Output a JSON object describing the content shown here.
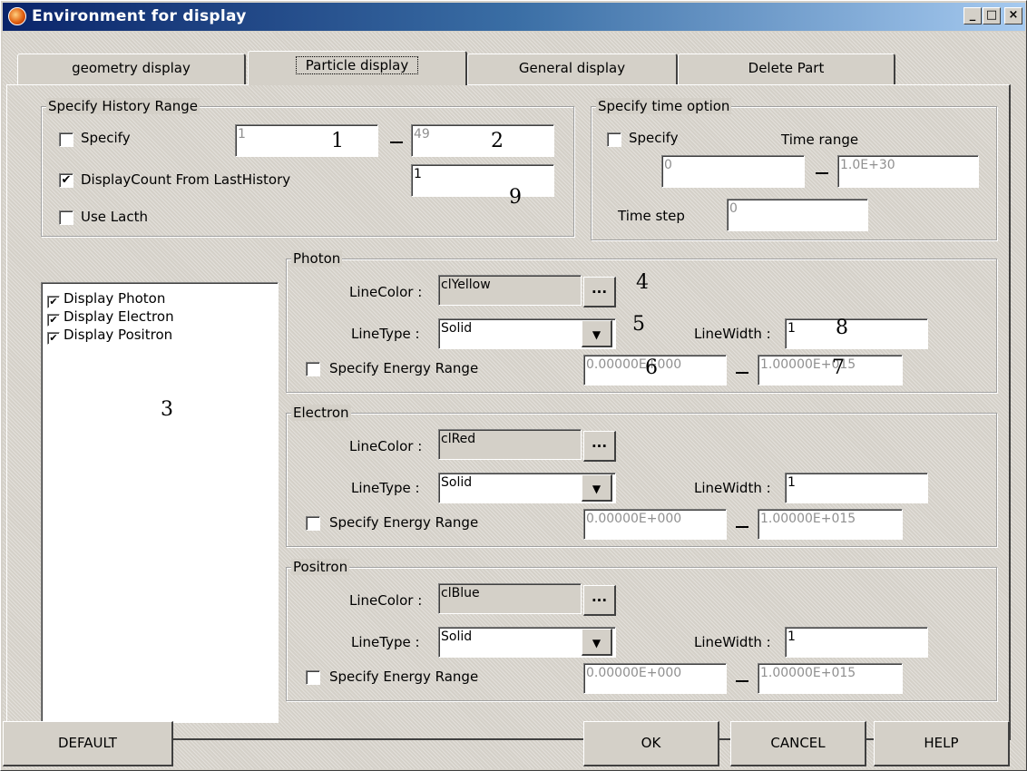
{
  "window": {
    "title": "Environment for display",
    "minimize": "_",
    "maximize": "□",
    "close": "×"
  },
  "tabs": [
    "geometry display",
    "Particle display",
    "General display",
    "Delete Part"
  ],
  "history": {
    "legend": "Specify History Range",
    "specify_label": "Specify",
    "specify_checked": false,
    "from_value": "1",
    "to_value": "49",
    "displaycount_label": "DisplayCount From LastHistory",
    "displaycount_checked": true,
    "displaycount_value": "1",
    "uselacth_label": "Use Lacth",
    "uselacth_checked": false
  },
  "time": {
    "legend": "Specify time option",
    "specify_label": "Specify",
    "specify_checked": false,
    "range_label": "Time range",
    "range_from": "0",
    "range_to": "1.0E+30",
    "step_label": "Time step",
    "step_value": "0"
  },
  "display_list": [
    {
      "label": "Display Photon",
      "checked": true
    },
    {
      "label": "Display Electron",
      "checked": true
    },
    {
      "label": "Display Positron",
      "checked": true
    }
  ],
  "particles": [
    {
      "legend": "Photon",
      "linecolor_label": "LineColor :",
      "linecolor_value": "clYellow",
      "browse_label": "...",
      "linetype_label": "LineType :",
      "linetype_value": "Solid",
      "linewidth_label": "LineWidth :",
      "linewidth_value": "1",
      "energy_label": "Specify Energy Range",
      "energy_checked": false,
      "energy_from": "0.00000E+000",
      "energy_to": "1.00000E+015"
    },
    {
      "legend": "Electron",
      "linecolor_label": "LineColor :",
      "linecolor_value": "clRed",
      "browse_label": "...",
      "linetype_label": "LineType :",
      "linetype_value": "Solid",
      "linewidth_label": "LineWidth :",
      "linewidth_value": "1",
      "energy_label": "Specify Energy Range",
      "energy_checked": false,
      "energy_from": "0.00000E+000",
      "energy_to": "1.00000E+015"
    },
    {
      "legend": "Positron",
      "linecolor_label": "LineColor :",
      "linecolor_value": "clBlue",
      "browse_label": "...",
      "linetype_label": "LineType :",
      "linetype_value": "Solid",
      "linewidth_label": "LineWidth :",
      "linewidth_value": "1",
      "energy_label": "Specify Energy Range",
      "energy_checked": false,
      "energy_from": "0.00000E+000",
      "energy_to": "1.00000E+015"
    }
  ],
  "buttons": {
    "default": "DEFAULT",
    "ok": "OK",
    "cancel": "CANCEL",
    "help": "HELP"
  },
  "annotations": [
    "1",
    "2",
    "3",
    "4",
    "5",
    "6",
    "7",
    "8",
    "9"
  ],
  "check_glyph": "✔",
  "combo_arrow_glyph": "▼"
}
